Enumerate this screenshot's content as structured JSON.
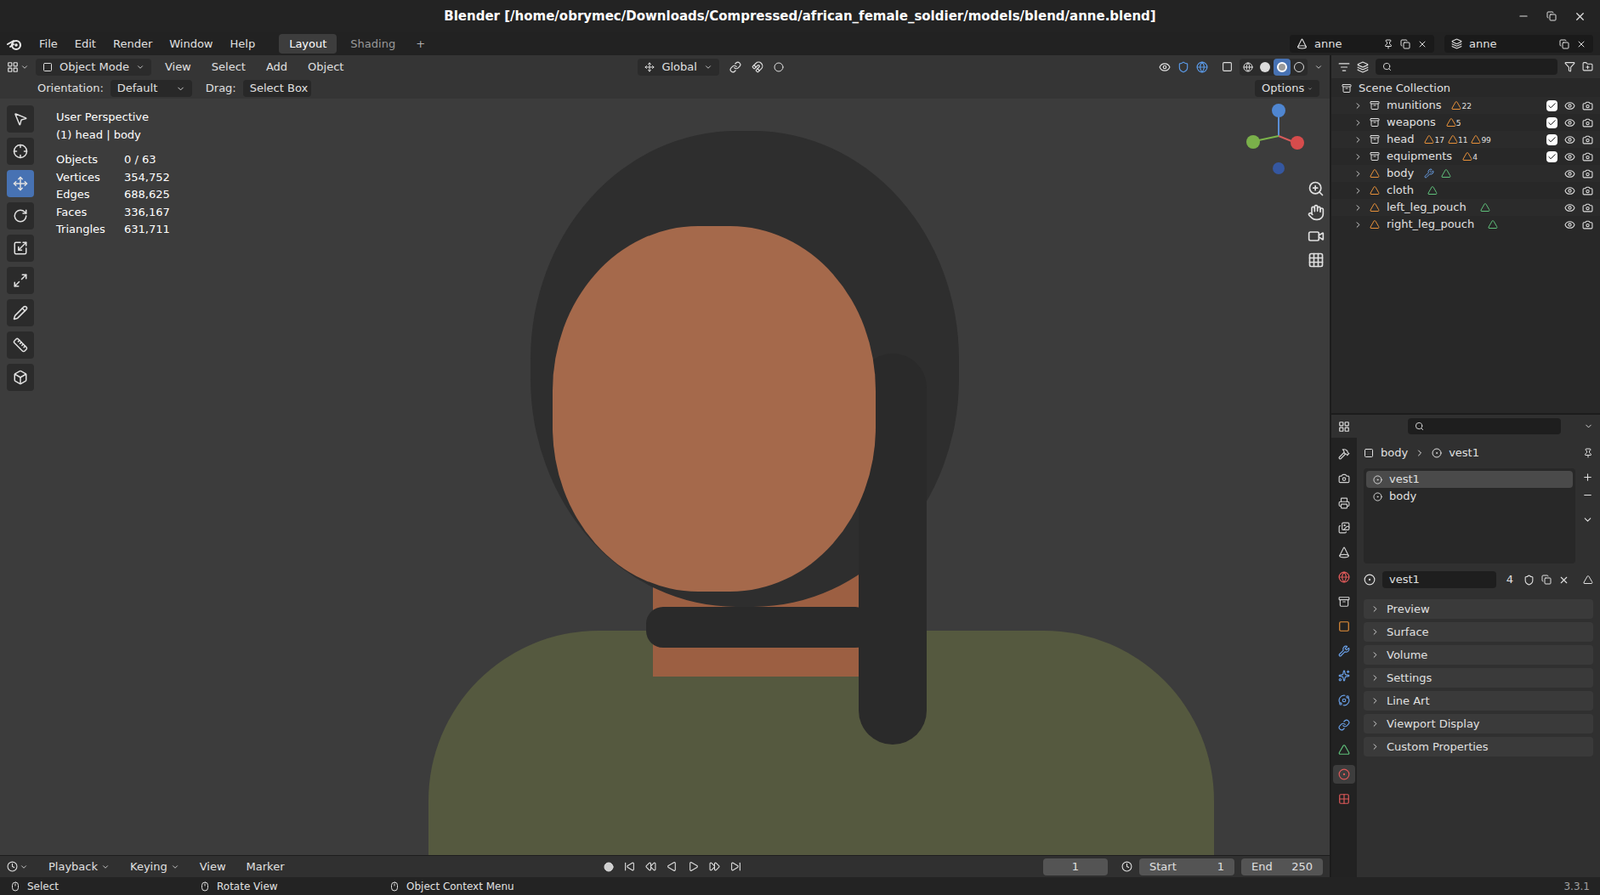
{
  "window": {
    "title": "Blender [/home/obrymec/Downloads/Compressed/african_female_soldier/models/blend/anne.blend]"
  },
  "menubar": {
    "menus": [
      "File",
      "Edit",
      "Render",
      "Window",
      "Help"
    ],
    "workspaces": [
      {
        "label": "Layout",
        "selected": true
      },
      {
        "label": "Shading",
        "selected": false
      }
    ],
    "add_workspace": "+",
    "scene": "anne",
    "view_layer": "anne"
  },
  "viewport": {
    "mode": "Object Mode",
    "menus": [
      "View",
      "Select",
      "Add",
      "Object"
    ],
    "orientation": "Global",
    "shading": [
      {
        "mode": "wireframe",
        "selected": false
      },
      {
        "mode": "solid",
        "selected": false
      },
      {
        "mode": "material",
        "selected": true
      },
      {
        "mode": "rendered",
        "selected": false
      }
    ],
    "tool_settings": {
      "orientation_label": "Orientation:",
      "orientation": "Default",
      "drag_label": "Drag:",
      "drag": "Select Box",
      "options": "Options"
    },
    "view_name": "User Perspective",
    "context": "(1) head | body",
    "stats": [
      {
        "label": "Objects",
        "value": "0 / 63"
      },
      {
        "label": "Vertices",
        "value": "354,752"
      },
      {
        "label": "Edges",
        "value": "688,625"
      },
      {
        "label": "Faces",
        "value": "336,167"
      },
      {
        "label": "Triangles",
        "value": "631,711"
      }
    ],
    "tools": [
      {
        "tool": "select",
        "selected": false
      },
      {
        "tool": "cursor",
        "selected": false
      },
      {
        "tool": "move",
        "selected": true
      },
      {
        "tool": "rotate",
        "selected": false
      },
      {
        "tool": "scale",
        "selected": false
      },
      {
        "tool": "transform",
        "selected": false
      },
      {
        "tool": "annotate",
        "selected": false
      },
      {
        "tool": "measure",
        "selected": false
      },
      {
        "tool": "add_cube",
        "selected": false
      }
    ]
  },
  "outliner": {
    "root": "Scene Collection",
    "items": [
      {
        "name": "munitions",
        "kind": "collection",
        "counts": [
          "22"
        ],
        "has_modifiers": false,
        "checked": true,
        "visible": true,
        "renderable": true
      },
      {
        "name": "weapons",
        "kind": "collection",
        "counts": [
          "5"
        ],
        "has_modifiers": false,
        "checked": true,
        "visible": true,
        "renderable": true
      },
      {
        "name": "head",
        "kind": "collection",
        "counts": [
          "17",
          "11",
          "99"
        ],
        "has_modifiers": false,
        "checked": true,
        "visible": true,
        "renderable": true
      },
      {
        "name": "equipments",
        "kind": "collection",
        "counts": [
          "4"
        ],
        "has_modifiers": false,
        "checked": true,
        "visible": true,
        "renderable": true
      },
      {
        "name": "body",
        "kind": "object",
        "counts": [],
        "has_modifiers": true,
        "checked": false,
        "visible": true,
        "renderable": true
      },
      {
        "name": "cloth",
        "kind": "object",
        "counts": [],
        "has_modifiers": false,
        "checked": false,
        "visible": true,
        "renderable": true
      },
      {
        "name": "left_leg_pouch",
        "kind": "object",
        "counts": [],
        "has_modifiers": false,
        "checked": false,
        "visible": true,
        "renderable": true
      },
      {
        "name": "right_leg_pouch",
        "kind": "object",
        "counts": [],
        "has_modifiers": false,
        "checked": false,
        "visible": true,
        "renderable": true
      }
    ]
  },
  "properties": {
    "breadcrumb": [
      "body",
      "vest1"
    ],
    "tabs": [
      {
        "tab": "tool",
        "selected": false
      },
      {
        "tab": "render",
        "selected": false
      },
      {
        "tab": "output",
        "selected": false
      },
      {
        "tab": "view_layer",
        "selected": false
      },
      {
        "tab": "scene",
        "selected": false
      },
      {
        "tab": "world",
        "selected": false
      },
      {
        "tab": "collection",
        "selected": false
      },
      {
        "tab": "object",
        "selected": false
      },
      {
        "tab": "modifiers",
        "selected": false
      },
      {
        "tab": "particles",
        "selected": false
      },
      {
        "tab": "physics",
        "selected": false
      },
      {
        "tab": "constraints",
        "selected": false
      },
      {
        "tab": "data",
        "selected": false
      },
      {
        "tab": "material",
        "selected": true
      },
      {
        "tab": "texture",
        "selected": false
      }
    ],
    "slots": [
      {
        "name": "vest1",
        "selected": true
      },
      {
        "name": "body",
        "selected": false
      }
    ],
    "material": "vest1",
    "users": "4",
    "panels": [
      {
        "label": "Preview",
        "expanded": false
      },
      {
        "label": "Surface",
        "expanded": false
      },
      {
        "label": "Volume",
        "expanded": false
      },
      {
        "label": "Settings",
        "expanded": false
      },
      {
        "label": "Line Art",
        "expanded": false
      },
      {
        "label": "Viewport Display",
        "expanded": false
      },
      {
        "label": "Custom Properties",
        "expanded": false
      }
    ]
  },
  "timeline": {
    "menus": [
      "Playback",
      "Keying",
      "View",
      "Marker"
    ],
    "frame": "1",
    "start_label": "Start",
    "start": "1",
    "end_label": "End",
    "end": "250"
  },
  "status_bar": {
    "hints": [
      "Select",
      "Rotate View",
      "Object Context Menu"
    ],
    "version": "3.3.1"
  }
}
